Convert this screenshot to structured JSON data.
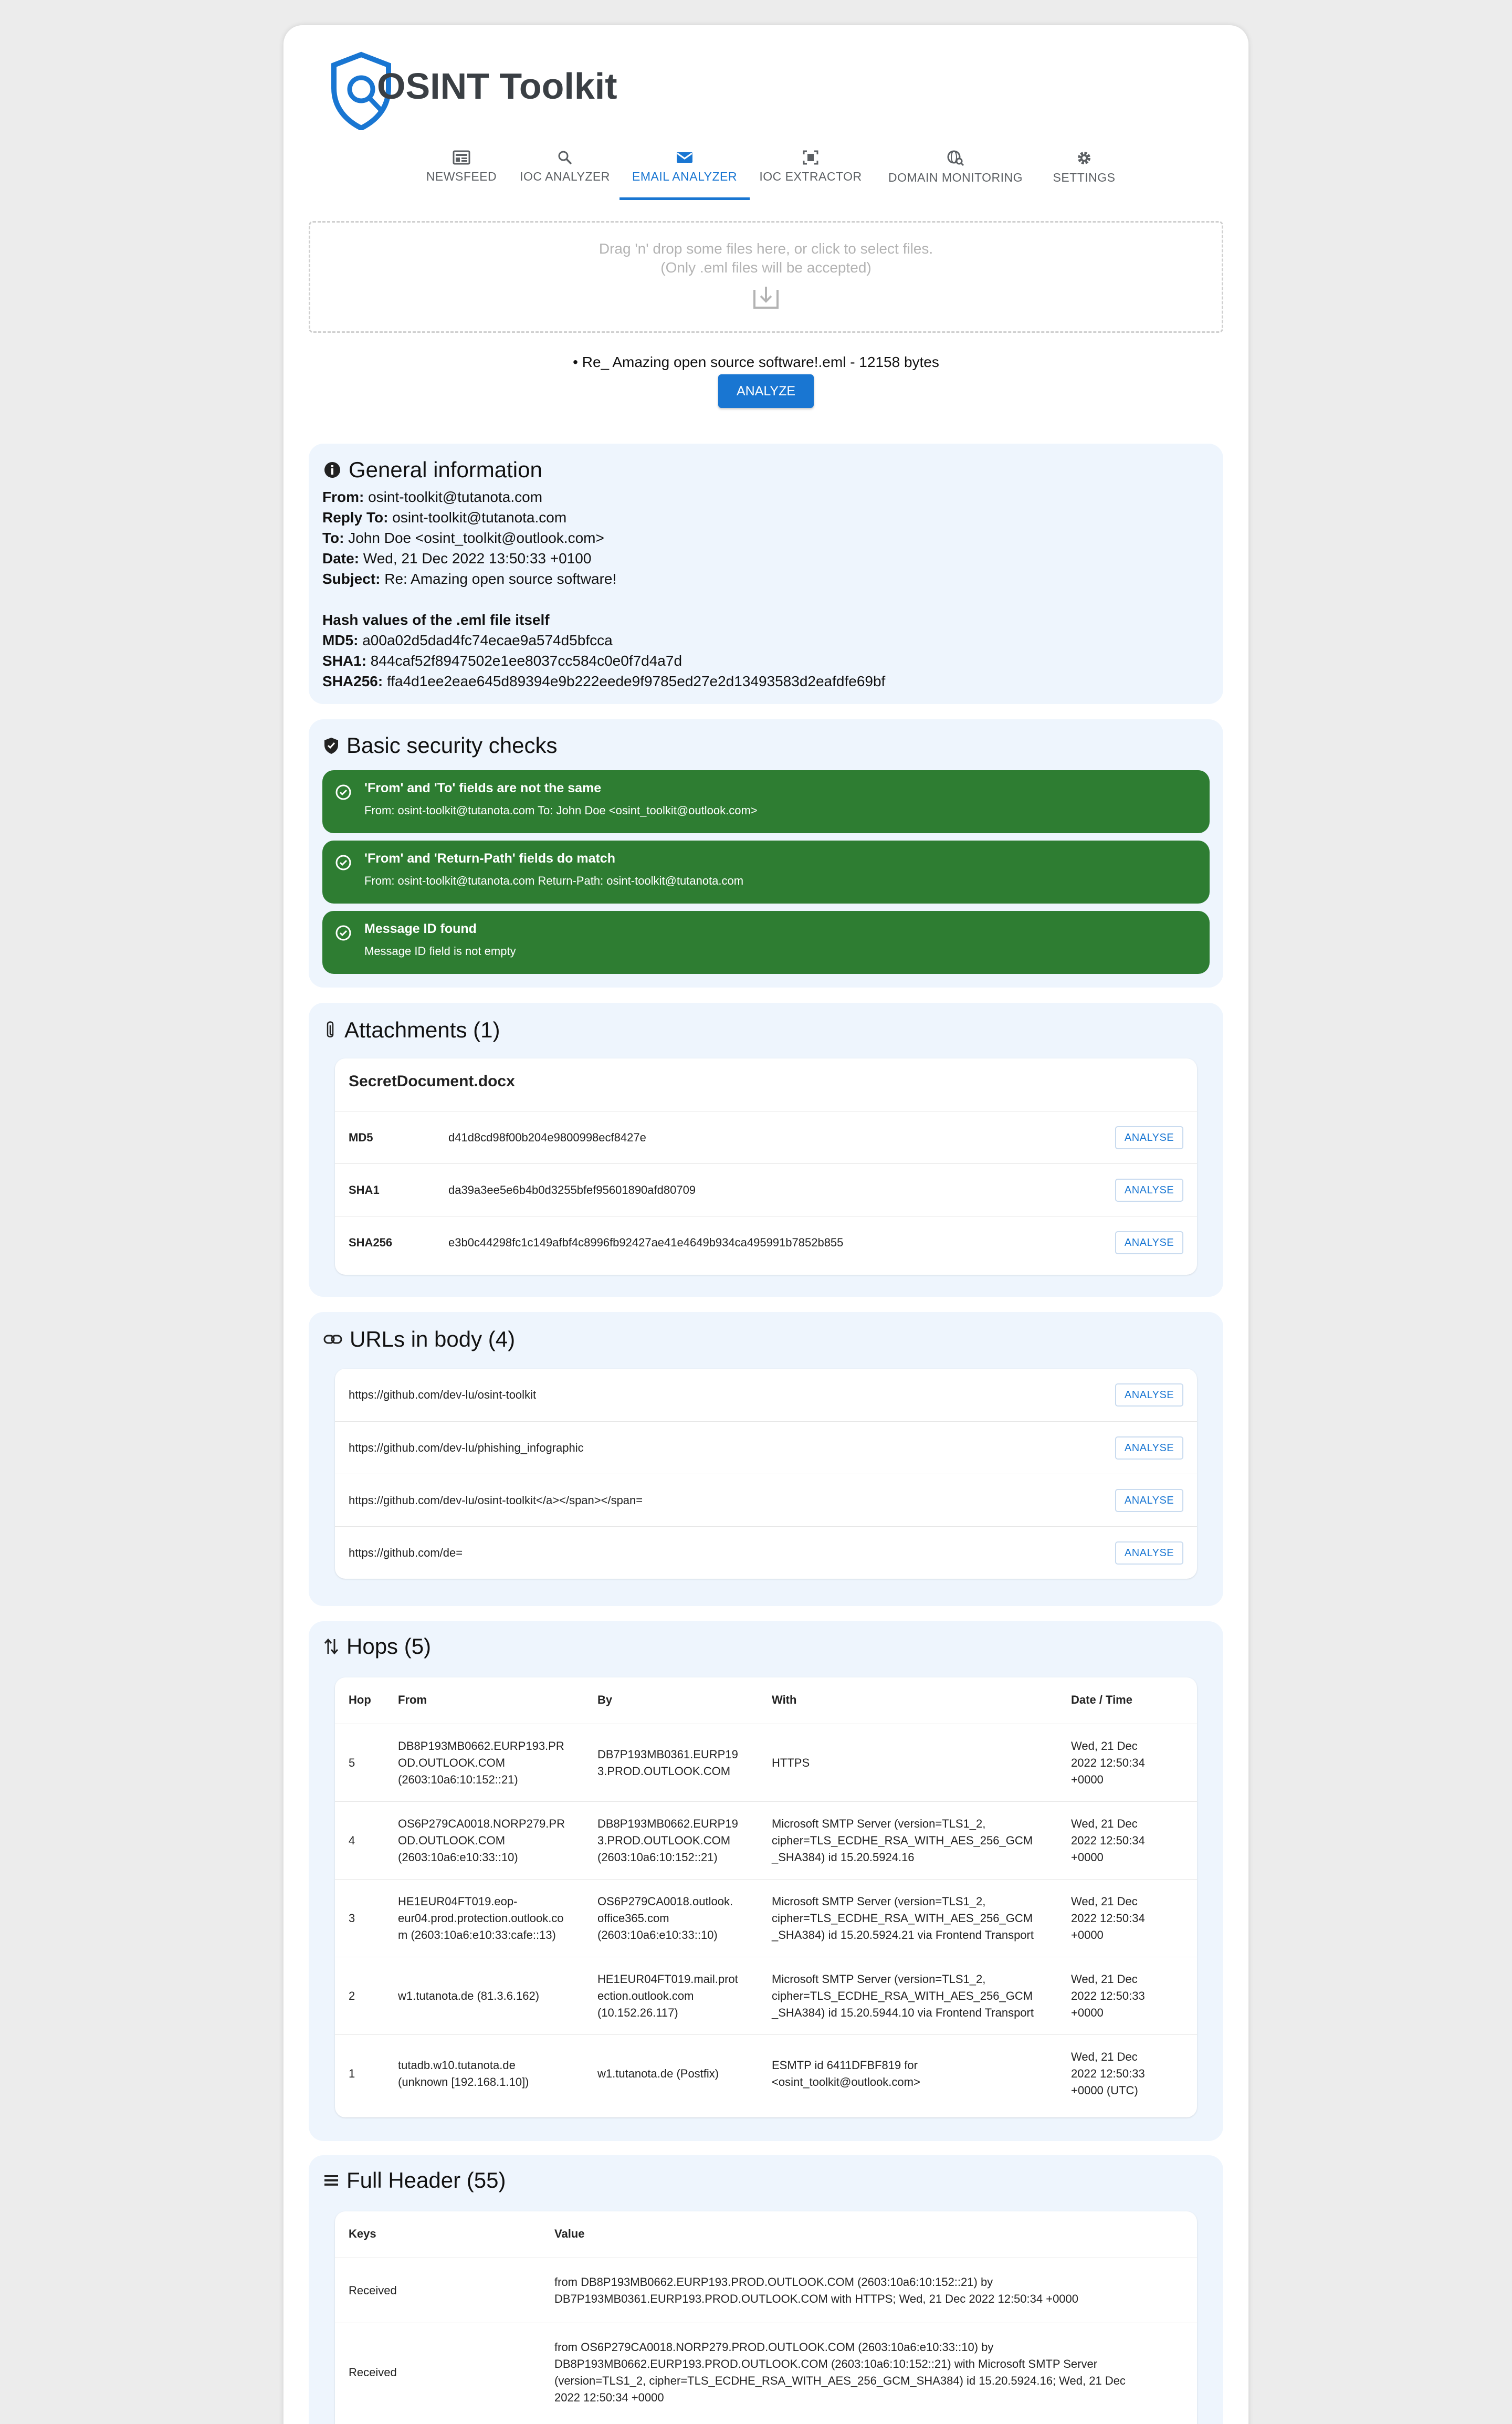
{
  "app": {
    "title": "OSINT Toolkit",
    "accent_color": "#1976d2"
  },
  "nav": {
    "tabs": [
      {
        "label": "NEWSFEED",
        "icon": "newspaper-icon"
      },
      {
        "label": "IOC ANALYZER",
        "icon": "search-icon"
      },
      {
        "label": "EMAIL ANALYZER",
        "icon": "mail-icon",
        "active": true
      },
      {
        "label": "IOC EXTRACTOR",
        "icon": "document-scan-icon"
      },
      {
        "label": "DOMAIN MONITORING",
        "icon": "domain-search-icon"
      },
      {
        "label": "SETTINGS",
        "icon": "gear-icon"
      }
    ]
  },
  "dropzone": {
    "line1": "Drag 'n' drop some files here, or click to select files.",
    "line2": "(Only .eml files will be accepted)"
  },
  "uploaded_file": "Re_ Amazing open source software!.eml - 12158 bytes",
  "analyze_button": "ANALYZE",
  "general": {
    "title": "General information",
    "from_label": "From:",
    "from": "osint-toolkit@tutanota.com",
    "reply_to_label": "Reply To:",
    "reply_to": "osint-toolkit@tutanota.com",
    "to_label": "To:",
    "to": "John Doe <osint_toolkit@outlook.com>",
    "date_label": "Date:",
    "date": "Wed, 21 Dec 2022 13:50:33 +0100",
    "subject_label": "Subject:",
    "subject": "Re: Amazing open source software!",
    "hash_title": "Hash values of the .eml file itself",
    "md5_label": "MD5:",
    "md5": "a00a02d5dad4fc74ecae9a574d5bfcca",
    "sha1_label": "SHA1:",
    "sha1": "844caf52f8947502e1ee8037cc584c0e0f7d4a7d",
    "sha256_label": "SHA256:",
    "sha256": "ffa4d1ee2eae645d89394e9b222eede9f9785ed27e2d13493583d2eafdfe69bf"
  },
  "security": {
    "title": "Basic security checks",
    "checks": [
      {
        "title": "'From' and 'To' fields are not the same",
        "detail": "From: osint-toolkit@tutanota.com To: John Doe <osint_toolkit@outlook.com>"
      },
      {
        "title": "'From' and 'Return-Path' fields do match",
        "detail": "From: osint-toolkit@tutanota.com Return-Path: osint-toolkit@tutanota.com"
      },
      {
        "title": "Message ID found",
        "detail": "Message ID field is not empty"
      }
    ],
    "ok_color": "#2e7d32"
  },
  "attachments": {
    "title": "Attachments (1)",
    "file_name": "SecretDocument.docx",
    "hashes": [
      {
        "label": "MD5",
        "value": "d41d8cd98f00b204e9800998ecf8427e",
        "button": "ANALYSE"
      },
      {
        "label": "SHA1",
        "value": "da39a3ee5e6b4b0d3255bfef95601890afd80709",
        "button": "ANALYSE"
      },
      {
        "label": "SHA256",
        "value": "e3b0c44298fc1c149afbf4c8996fb92427ae41e4649b934ca495991b7852b855",
        "button": "ANALYSE"
      }
    ]
  },
  "urls": {
    "title": "URLs in body (4)",
    "items": [
      {
        "url": "https://github.com/dev-lu/osint-toolkit",
        "button": "ANALYSE"
      },
      {
        "url": "https://github.com/dev-lu/phishing_infographic",
        "button": "ANALYSE"
      },
      {
        "url": "https://github.com/dev-lu/osint-toolkit</a></span></span=",
        "button": "ANALYSE"
      },
      {
        "url": "https://github.com/de=",
        "button": "ANALYSE"
      }
    ]
  },
  "hops": {
    "title": "Hops (5)",
    "columns": [
      "Hop",
      "From",
      "By",
      "With",
      "Date / Time"
    ],
    "rows": [
      {
        "hop": "5",
        "from": [
          "DB8P193MB0662.EURP193.PR",
          "OD.OUTLOOK.COM",
          "(2603:10a6:10:152::21)"
        ],
        "by": [
          "DB7P193MB0361.EURP19",
          "3.PROD.OUTLOOK.COM"
        ],
        "with": [
          "HTTPS"
        ],
        "date": [
          "Wed, 21 Dec",
          "2022 12:50:34",
          "+0000"
        ]
      },
      {
        "hop": "4",
        "from": [
          "OS6P279CA0018.NORP279.PR",
          "OD.OUTLOOK.COM",
          "(2603:10a6:e10:33::10)"
        ],
        "by": [
          "DB8P193MB0662.EURP19",
          "3.PROD.OUTLOOK.COM",
          "(2603:10a6:10:152::21)"
        ],
        "with": [
          "Microsoft SMTP Server (version=TLS1_2,",
          "cipher=TLS_ECDHE_RSA_WITH_AES_256_GCM",
          "_SHA384) id 15.20.5924.16"
        ],
        "date": [
          "Wed, 21 Dec",
          "2022 12:50:34",
          "+0000"
        ]
      },
      {
        "hop": "3",
        "from": [
          "HE1EUR04FT019.eop-",
          "eur04.prod.protection.outlook.co",
          "m (2603:10a6:e10:33:cafe::13)"
        ],
        "by": [
          "OS6P279CA0018.outlook.",
          "office365.com",
          "(2603:10a6:e10:33::10)"
        ],
        "with": [
          "Microsoft SMTP Server (version=TLS1_2,",
          "cipher=TLS_ECDHE_RSA_WITH_AES_256_GCM",
          "_SHA384) id 15.20.5924.21 via Frontend Transport"
        ],
        "date": [
          "Wed, 21 Dec",
          "2022 12:50:34",
          "+0000"
        ]
      },
      {
        "hop": "2",
        "from": [
          "w1.tutanota.de (81.3.6.162)"
        ],
        "by": [
          "HE1EUR04FT019.mail.prot",
          "ection.outlook.com",
          "(10.152.26.117)"
        ],
        "with": [
          "Microsoft SMTP Server (version=TLS1_2,",
          "cipher=TLS_ECDHE_RSA_WITH_AES_256_GCM",
          "_SHA384) id 15.20.5944.10 via Frontend Transport"
        ],
        "date": [
          "Wed, 21 Dec",
          "2022 12:50:33",
          "+0000"
        ]
      },
      {
        "hop": "1",
        "from": [
          "tutadb.w10.tutanota.de",
          "(unknown [192.168.1.10])"
        ],
        "by": [
          "w1.tutanota.de (Postfix)"
        ],
        "with": [
          "ESMTP id 6411DFBF819 for",
          "<osint_toolkit@outlook.com>"
        ],
        "date": [
          "Wed, 21 Dec",
          "2022 12:50:33",
          "+0000 (UTC)"
        ]
      }
    ]
  },
  "full_header": {
    "title": "Full Header (55)",
    "columns": [
      "Keys",
      "Value"
    ],
    "rows": [
      {
        "key": "Received",
        "value": [
          "from DB8P193MB0662.EURP193.PROD.OUTLOOK.COM (2603:10a6:10:152::21) by",
          "DB7P193MB0361.EURP193.PROD.OUTLOOK.COM with HTTPS; Wed, 21 Dec 2022 12:50:34 +0000"
        ]
      },
      {
        "key": "Received",
        "value": [
          "from OS6P279CA0018.NORP279.PROD.OUTLOOK.COM (2603:10a6:e10:33::10) by",
          "DB8P193MB0662.EURP193.PROD.OUTLOOK.COM (2603:10a6:10:152::21) with Microsoft SMTP Server",
          "(version=TLS1_2, cipher=TLS_ECDHE_RSA_WITH_AES_256_GCM_SHA384) id 15.20.5924.16; Wed, 21 Dec",
          "2022 12:50:34 +0000"
        ]
      }
    ]
  }
}
